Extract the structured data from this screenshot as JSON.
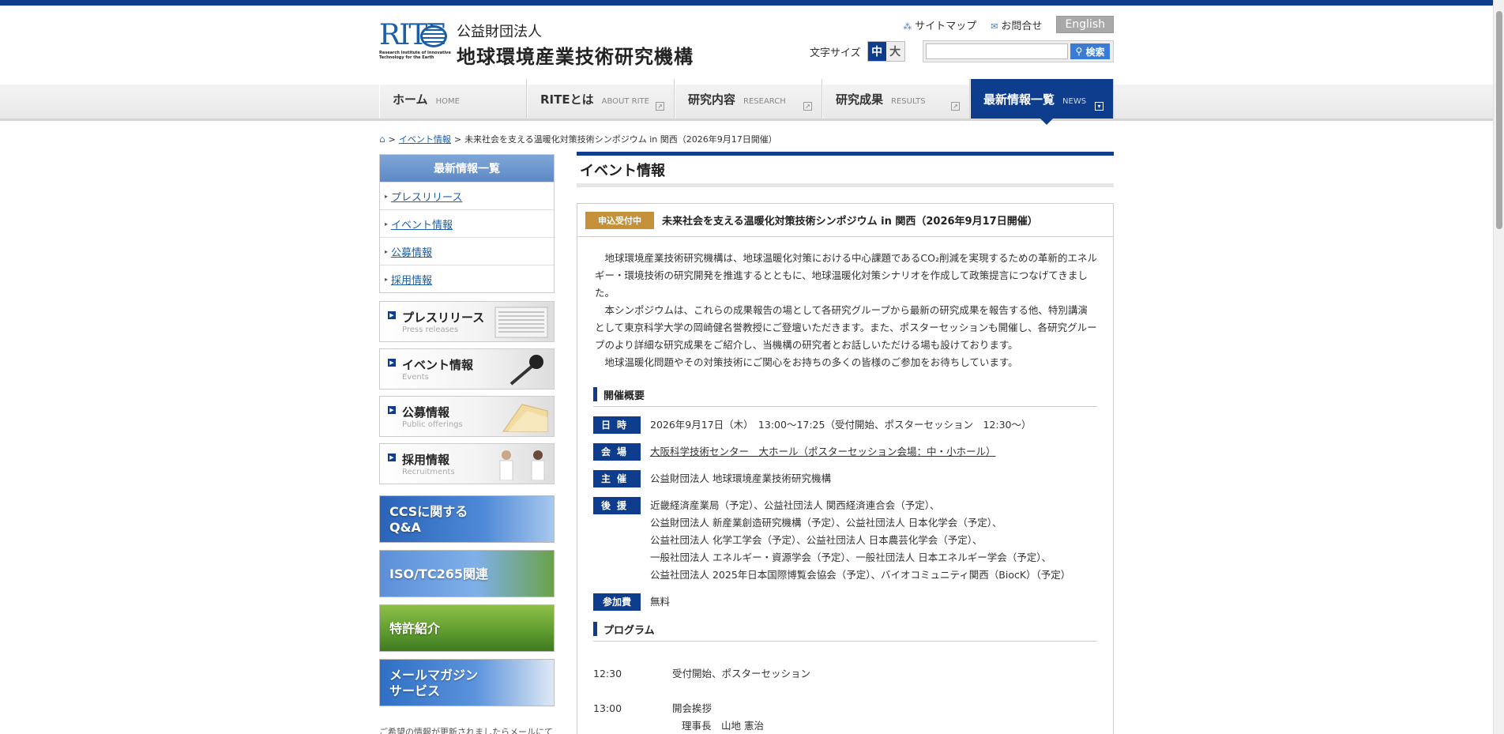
{
  "header": {
    "logo_text": "RITE",
    "logo_sub": "Research Institute of Innovative Technology for the Earth",
    "org_small": "公益財団法人",
    "org_big": "地球環境産業技術研究機構",
    "sitemap": "サイトマップ",
    "contact": "お問合せ",
    "english": "English",
    "font_size_label": "文字サイズ",
    "font_medium": "中",
    "font_large": "大",
    "search_placeholder": "",
    "search_button": "検索"
  },
  "nav": [
    {
      "jp": "ホーム",
      "en": "HOME"
    },
    {
      "jp": "RITEとは",
      "en": "ABOUT RITE"
    },
    {
      "jp": "研究内容",
      "en": "RESEARCH"
    },
    {
      "jp": "研究成果",
      "en": "RESULTS"
    },
    {
      "jp": "最新情報一覧",
      "en": "NEWS"
    }
  ],
  "breadcrumb": {
    "link": "イベント情報",
    "current": "未来社会を支える温暖化対策技術シンポジウム in 関西（2026年9月17日開催）"
  },
  "sidebar": {
    "title": "最新情報一覧",
    "items": [
      "プレスリリース",
      "イベント情報",
      "公募情報",
      "採用情報"
    ],
    "banners": [
      {
        "title": "プレスリリース",
        "sub": "Press releases"
      },
      {
        "title": "イベント情報",
        "sub": "Events"
      },
      {
        "title": "公募情報",
        "sub": "Public offerings"
      },
      {
        "title": "採用情報",
        "sub": "Recruitments"
      }
    ],
    "color_banners": [
      {
        "line1": "CCSに関する",
        "line2": "Q&A"
      },
      {
        "line1": "ISO/TC265関連",
        "line2": ""
      },
      {
        "line1": "特許紹介",
        "line2": ""
      },
      {
        "line1": "メールマガジン",
        "line2": "サービス"
      }
    ],
    "bottom_text": "ご希望の情報が更新されましたらメールにて"
  },
  "main": {
    "page_title": "イベント情報",
    "status": "申込受付中",
    "event_title": "未来社会を支える温暖化対策技術シンポジウム in 関西（2026年9月17日開催）",
    "intro": [
      "地球環境産業技術研究機構は、地球温暖化対策における中心課題であるCO₂削減を実現するための革新的エネルギー・環境技術の研究開発を推進するとともに、地球温暖化対策シナリオを作成して政策提言につなげてきました。",
      "本シンポジウムは、これらの成果報告の場として各研究グループから最新の研究成果を報告する他、特別講演として東京科学大学の岡崎健名誉教授にご登壇いただきます。また、ポスターセッションも開催し、各研究グループのより詳細な研究成果をご紹介し、当機構の研究者とお話しいただける場も設けております。",
      "地球温暖化問題やその対策技術にご関心をお持ちの多くの皆様のご参加をお待ちしています。"
    ],
    "overview_title": "開催概要",
    "overview": {
      "date_label": "日時",
      "date": "2026年9月17日（木）　13:00～17:25（受付開始、ポスターセッション　12:30～）",
      "venue_label": "会場",
      "venue": "大阪科学技術センター　大ホール（ポスターセッション会場：中・小ホール）",
      "host_label": "主催",
      "host": "公益財団法人 地球環境産業技術研究機構",
      "support_label": "後援",
      "support": [
        "近畿経済産業局（予定）、公益社団法人 関西経済連合会（予定）、",
        "公益財団法人 新産業創造研究機構（予定）、公益社団法人 日本化学会（予定）、",
        "公益社団法人 化学工学会（予定）、公益社団法人 日本農芸化学会（予定）、",
        "一般社団法人 エネルギー・資源学会（予定）、一般社団法人 日本エネルギー学会（予定）、",
        "公益社団法人 2025年日本国際博覧会協会（予定）、バイオコミュニティ関西（BiocK）（予定）"
      ],
      "fee_label": "参加費",
      "fee": "無料"
    },
    "program_title": "プログラム",
    "program": [
      {
        "time": "12:30",
        "desc": "受付開始、ポスターセッション",
        "sub": ""
      },
      {
        "time": "13:00",
        "desc": "開会挨拶",
        "sub": "理事長　山地 憲治"
      }
    ]
  }
}
